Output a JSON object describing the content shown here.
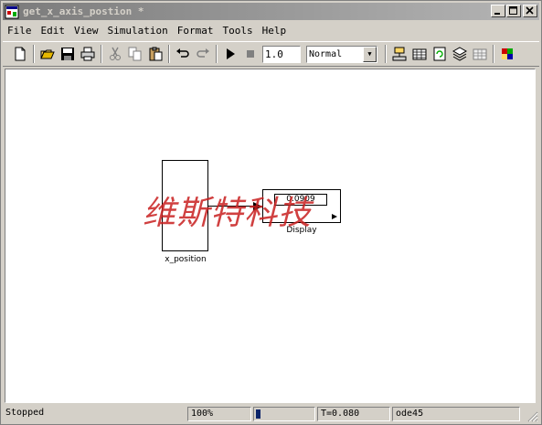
{
  "window": {
    "title": "get_x_axis_postion *"
  },
  "menu": [
    "File",
    "Edit",
    "View",
    "Simulation",
    "Format",
    "Tools",
    "Help"
  ],
  "toolbar": {
    "stop_time": "1.0",
    "sim_mode": "Normal"
  },
  "canvas": {
    "block_xpos": {
      "label": "x_position"
    },
    "block_display": {
      "label": "Display",
      "value": "0.0909"
    },
    "watermark": "维斯特科技"
  },
  "status": {
    "state": "Stopped",
    "zoom": "100%",
    "progress": 0.08,
    "time": "T=0.080",
    "solver": "ode45"
  }
}
